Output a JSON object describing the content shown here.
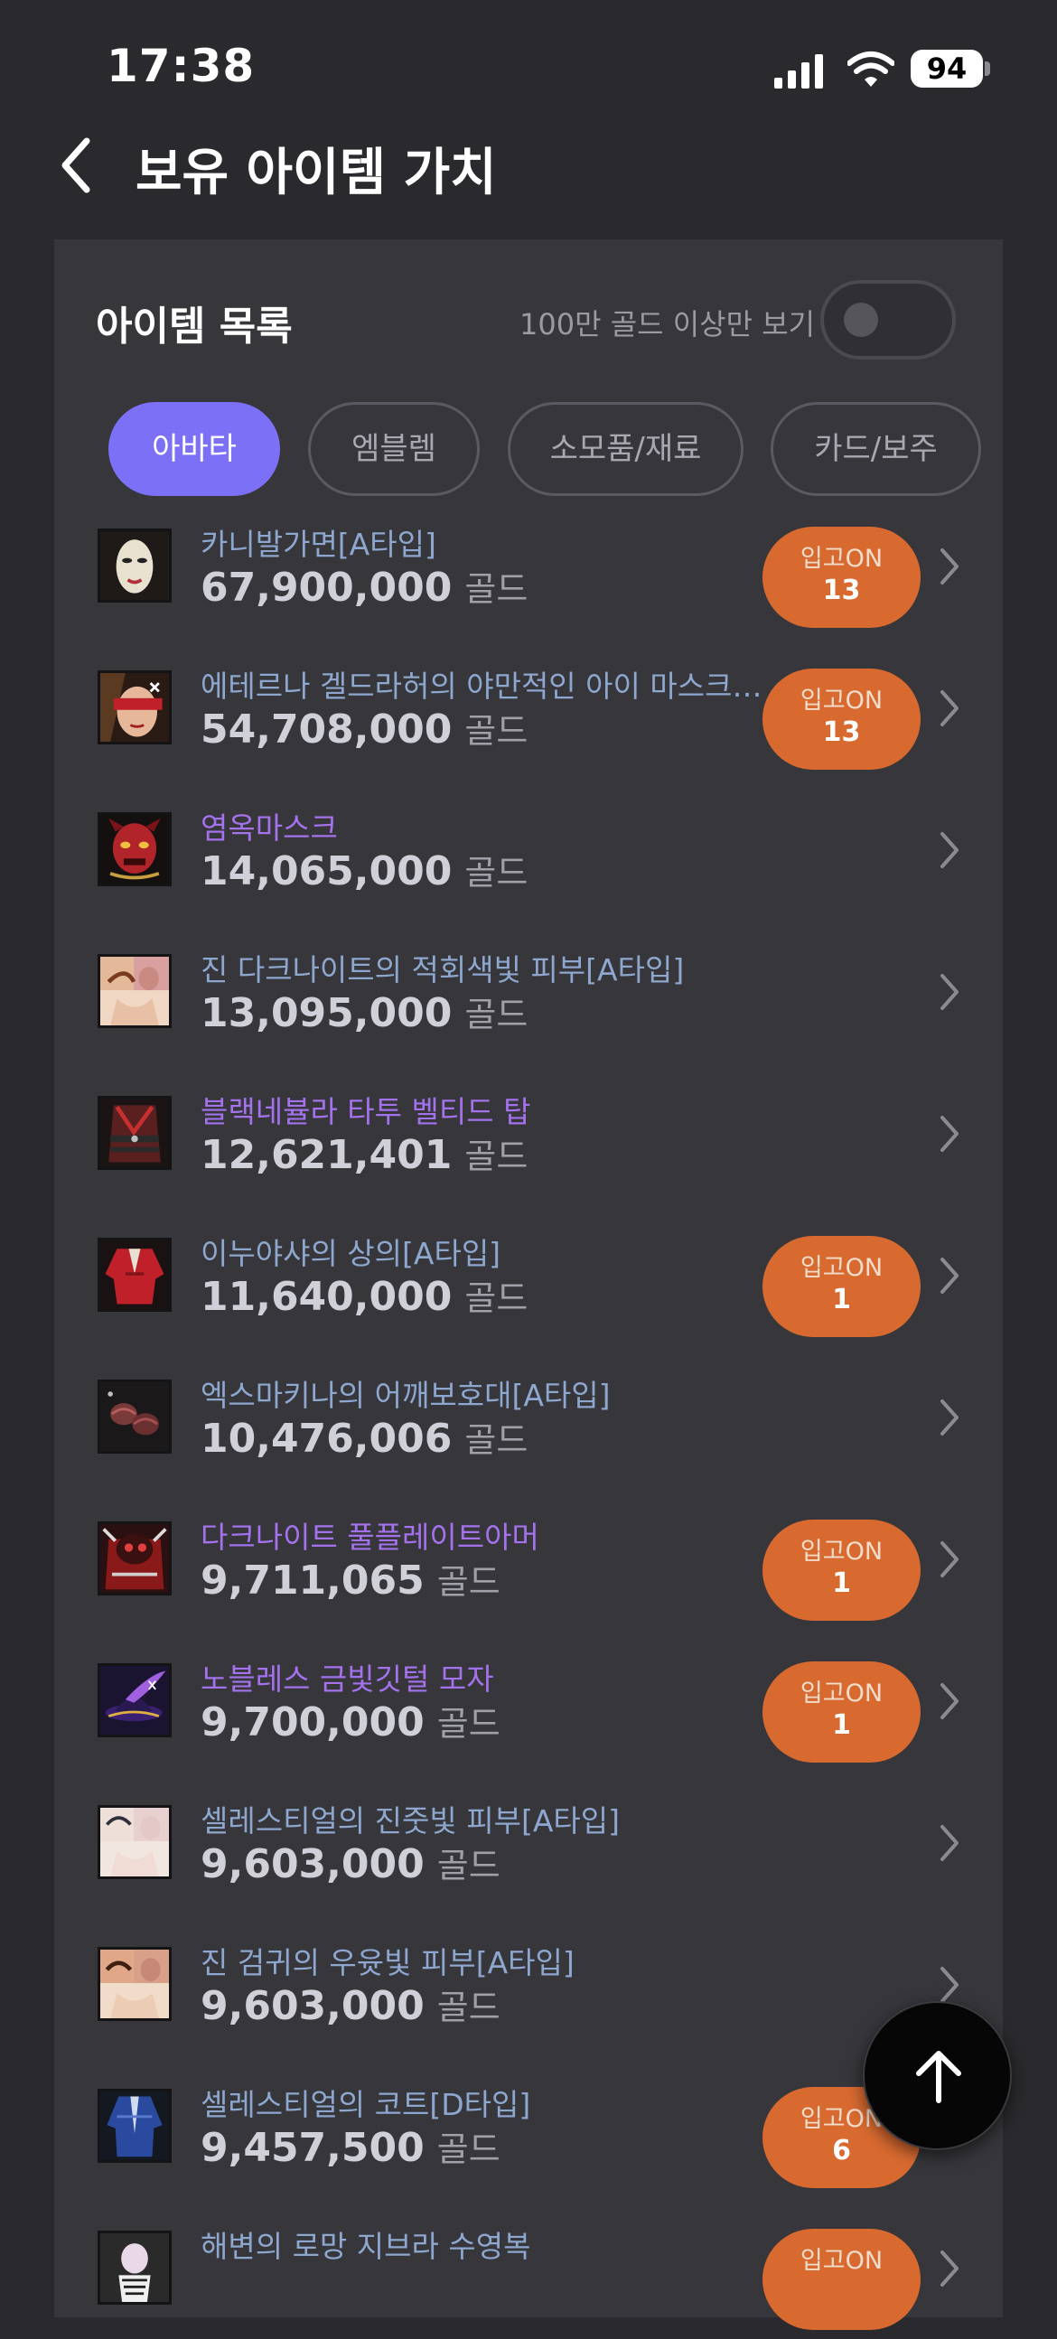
{
  "status_bar": {
    "time": "17:38",
    "battery": "94"
  },
  "header": {
    "title": "보유 아이템 가치"
  },
  "list_header": {
    "title": "아이템 목록",
    "filter_label": "100만 골드 이상만 보기",
    "filter_on": false
  },
  "tabs": [
    {
      "label": "아바타",
      "active": true
    },
    {
      "label": "엠블렘",
      "active": false
    },
    {
      "label": "소모품/재료",
      "active": false
    },
    {
      "label": "카드/보주",
      "active": false
    }
  ],
  "currency_unit": "골드",
  "badge_label": "입고ON",
  "items": [
    {
      "name": "카니발가면[A타입]",
      "price": "67,900,000",
      "name_color": "blue",
      "stock": "13",
      "icon": "white-mask"
    },
    {
      "name": "에테르나 겔드라허의 야만적인 아이 마스크…",
      "price": "54,708,000",
      "name_color": "blue",
      "stock": "13",
      "icon": "blindfold-face"
    },
    {
      "name": "염옥마스크",
      "price": "14,065,000",
      "name_color": "purple",
      "stock": null,
      "icon": "red-demon-mask"
    },
    {
      "name": "진 다크나이트의 적회색빛 피부[A타입]",
      "price": "13,095,000",
      "name_color": "blue",
      "stock": null,
      "icon": "skin-portrait"
    },
    {
      "name": "블랙네뷸라 타투 벨티드 탑",
      "price": "12,621,401",
      "name_color": "purple",
      "stock": null,
      "icon": "belted-top"
    },
    {
      "name": "이누야샤의 상의[A타입]",
      "price": "11,640,000",
      "name_color": "blue",
      "stock": "1",
      "icon": "red-robe"
    },
    {
      "name": "엑스마키나의 어깨보호대[A타입]",
      "price": "10,476,006",
      "name_color": "blue",
      "stock": null,
      "icon": "shoulder-guard"
    },
    {
      "name": "다크나이트 풀플레이트아머",
      "price": "9,711,065",
      "name_color": "purple",
      "stock": "1",
      "icon": "plate-armor"
    },
    {
      "name": "노블레스 금빛깃털 모자",
      "price": "9,700,000",
      "name_color": "purple",
      "stock": "1",
      "icon": "feather-hat"
    },
    {
      "name": "셀레스티얼의 진줏빛 피부[A타입]",
      "price": "9,603,000",
      "name_color": "blue",
      "stock": null,
      "icon": "pearl-skin"
    },
    {
      "name": "진 검귀의 우윳빛 피부[A타입]",
      "price": "9,603,000",
      "name_color": "blue",
      "stock": null,
      "icon": "milky-skin"
    },
    {
      "name": "셀레스티얼의 코트[D타입]",
      "price": "9,457,500",
      "name_color": "blue",
      "stock": "6",
      "icon": "blue-coat"
    },
    {
      "name": "해변의 로망 지브라 수영복",
      "price": "",
      "name_color": "blue",
      "stock": "",
      "icon": "swimsuit"
    }
  ],
  "colors": {
    "background": "#2a2a2e",
    "card": "#36363b",
    "accent": "#7c70f7",
    "badge": "#d86a30",
    "name_blue": "#8ea7cf",
    "name_purple": "#a472ec"
  }
}
